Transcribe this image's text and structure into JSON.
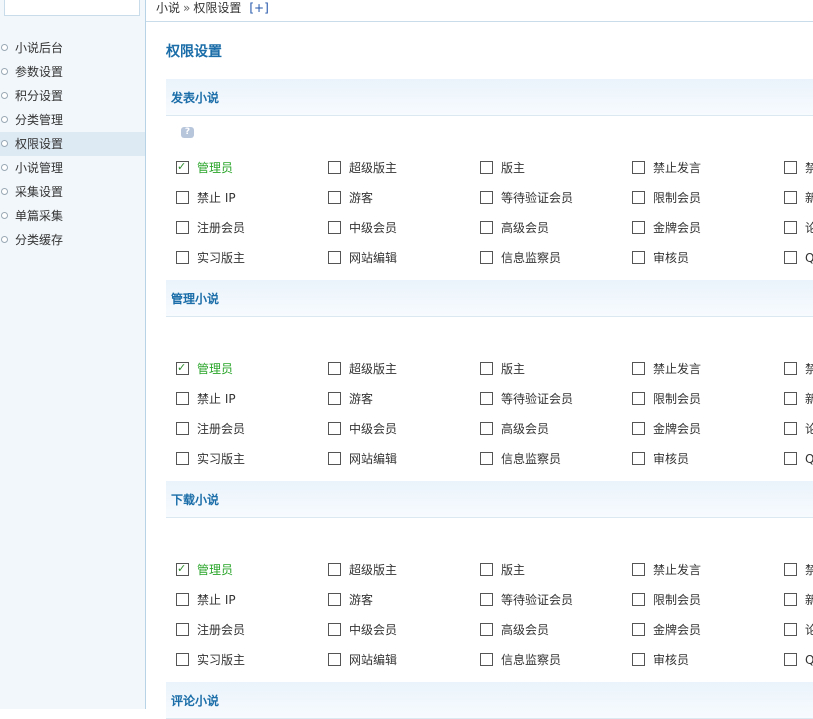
{
  "breadcrumb": {
    "items": [
      "小说",
      "权限设置"
    ],
    "separator": "»",
    "add_link": "[+]"
  },
  "sidebar": {
    "items": [
      {
        "label": "小说后台"
      },
      {
        "label": "参数设置"
      },
      {
        "label": "积分设置"
      },
      {
        "label": "分类管理"
      },
      {
        "label": "权限设置",
        "active": true
      },
      {
        "label": "小说管理"
      },
      {
        "label": "采集设置"
      },
      {
        "label": "单篇采集"
      },
      {
        "label": "分类缓存"
      }
    ]
  },
  "page_title": "权限设置",
  "help_icon": "question-icon",
  "sections": [
    {
      "title": "发表小说",
      "options": [
        {
          "label": "管理员",
          "checked": true
        },
        {
          "label": "超级版主",
          "checked": false
        },
        {
          "label": "版主",
          "checked": false
        },
        {
          "label": "禁止发言",
          "checked": false
        },
        {
          "label": "禁",
          "checked": false
        },
        {
          "label": "禁止 IP",
          "checked": false
        },
        {
          "label": "游客",
          "checked": false
        },
        {
          "label": "等待验证会员",
          "checked": false
        },
        {
          "label": "限制会员",
          "checked": false
        },
        {
          "label": "新",
          "checked": false
        },
        {
          "label": "注册会员",
          "checked": false
        },
        {
          "label": "中级会员",
          "checked": false
        },
        {
          "label": "高级会员",
          "checked": false
        },
        {
          "label": "金牌会员",
          "checked": false
        },
        {
          "label": "论",
          "checked": false
        },
        {
          "label": "实习版主",
          "checked": false
        },
        {
          "label": "网站编辑",
          "checked": false
        },
        {
          "label": "信息监察员",
          "checked": false
        },
        {
          "label": "审核员",
          "checked": false
        },
        {
          "label": "Q",
          "checked": false
        }
      ]
    },
    {
      "title": "管理小说",
      "options": [
        {
          "label": "管理员",
          "checked": true
        },
        {
          "label": "超级版主",
          "checked": false
        },
        {
          "label": "版主",
          "checked": false
        },
        {
          "label": "禁止发言",
          "checked": false
        },
        {
          "label": "禁",
          "checked": false
        },
        {
          "label": "禁止 IP",
          "checked": false
        },
        {
          "label": "游客",
          "checked": false
        },
        {
          "label": "等待验证会员",
          "checked": false
        },
        {
          "label": "限制会员",
          "checked": false
        },
        {
          "label": "新",
          "checked": false
        },
        {
          "label": "注册会员",
          "checked": false
        },
        {
          "label": "中级会员",
          "checked": false
        },
        {
          "label": "高级会员",
          "checked": false
        },
        {
          "label": "金牌会员",
          "checked": false
        },
        {
          "label": "论",
          "checked": false
        },
        {
          "label": "实习版主",
          "checked": false
        },
        {
          "label": "网站编辑",
          "checked": false
        },
        {
          "label": "信息监察员",
          "checked": false
        },
        {
          "label": "审核员",
          "checked": false
        },
        {
          "label": "Q",
          "checked": false
        }
      ]
    },
    {
      "title": "下载小说",
      "options": [
        {
          "label": "管理员",
          "checked": true
        },
        {
          "label": "超级版主",
          "checked": false
        },
        {
          "label": "版主",
          "checked": false
        },
        {
          "label": "禁止发言",
          "checked": false
        },
        {
          "label": "禁",
          "checked": false
        },
        {
          "label": "禁止 IP",
          "checked": false
        },
        {
          "label": "游客",
          "checked": false
        },
        {
          "label": "等待验证会员",
          "checked": false
        },
        {
          "label": "限制会员",
          "checked": false
        },
        {
          "label": "新",
          "checked": false
        },
        {
          "label": "注册会员",
          "checked": false
        },
        {
          "label": "中级会员",
          "checked": false
        },
        {
          "label": "高级会员",
          "checked": false
        },
        {
          "label": "金牌会员",
          "checked": false
        },
        {
          "label": "论",
          "checked": false
        },
        {
          "label": "实习版主",
          "checked": false
        },
        {
          "label": "网站编辑",
          "checked": false
        },
        {
          "label": "信息监察员",
          "checked": false
        },
        {
          "label": "审核员",
          "checked": false
        },
        {
          "label": "Q",
          "checked": false
        }
      ]
    },
    {
      "title": "评论小说",
      "options": []
    }
  ],
  "colors": {
    "accent": "#1a6da8",
    "checked_label": "#2aa52a",
    "sidebar_bg": "#f2f7fb",
    "sidebar_active": "#dde9f3"
  }
}
